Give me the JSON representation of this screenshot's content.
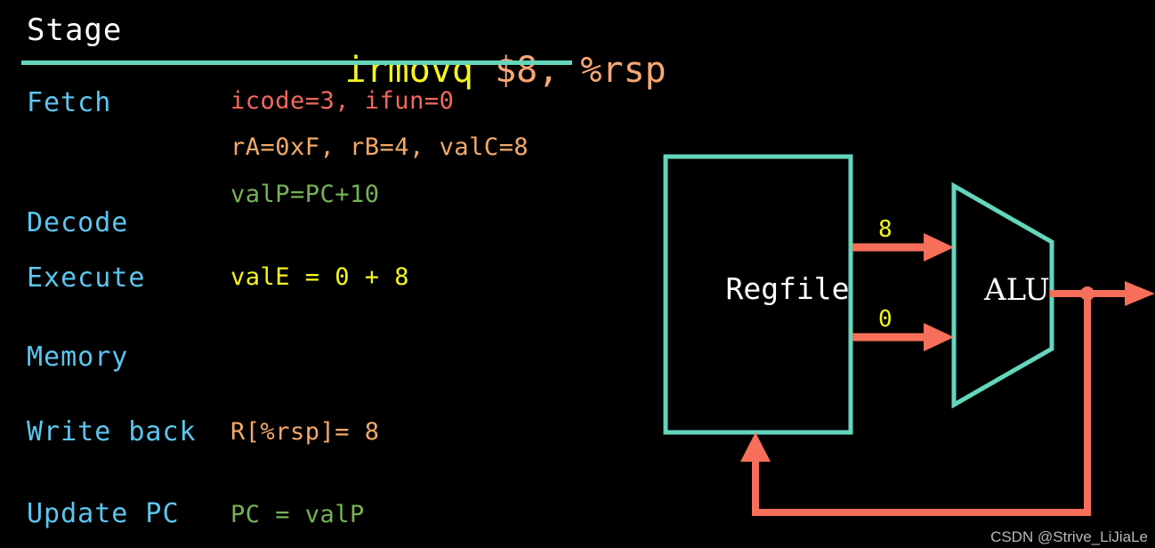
{
  "theme": {
    "background": "#000000",
    "accent_teal": "#63d6bc",
    "accent_salmon": "#f76f5a",
    "stage_blue": "#5bc6ee",
    "value_red": "#f4685e",
    "value_orange": "#f4a968",
    "value_green": "#76b255",
    "value_yellow": "#f5f520",
    "white": "#ffffff"
  },
  "header": {
    "stage_label": "Stage",
    "instruction_op": "irmovq",
    "instruction_args": " $8, %rsp"
  },
  "rows": [
    {
      "stage": "Fetch",
      "value": "icode=3, ifun=0",
      "color_class": "c-red"
    },
    {
      "stage": "",
      "value": "rA=0xF, rB=4, valC=8",
      "color_class": "c-orange"
    },
    {
      "stage": "",
      "value": "valP=PC+10",
      "color_class": "c-green"
    },
    {
      "stage": "Decode",
      "value": "",
      "color_class": "c-green"
    },
    {
      "stage": "Execute",
      "value": "valE = 0 + 8",
      "color_class": "c-yellow"
    },
    {
      "stage": "Memory",
      "value": "",
      "color_class": "c-green"
    },
    {
      "stage": "Write back",
      "value": "R[%rsp]= 8",
      "color_class": "c-orange"
    },
    {
      "stage": "Update PC",
      "value": "PC = valP",
      "color_class": "c-green"
    }
  ],
  "diagram": {
    "regfile_label": "Regfile",
    "alu_label": "ALU",
    "operand_top": "8",
    "operand_bottom": "0"
  },
  "watermark": "CSDN @Strive_LiJiaLe"
}
